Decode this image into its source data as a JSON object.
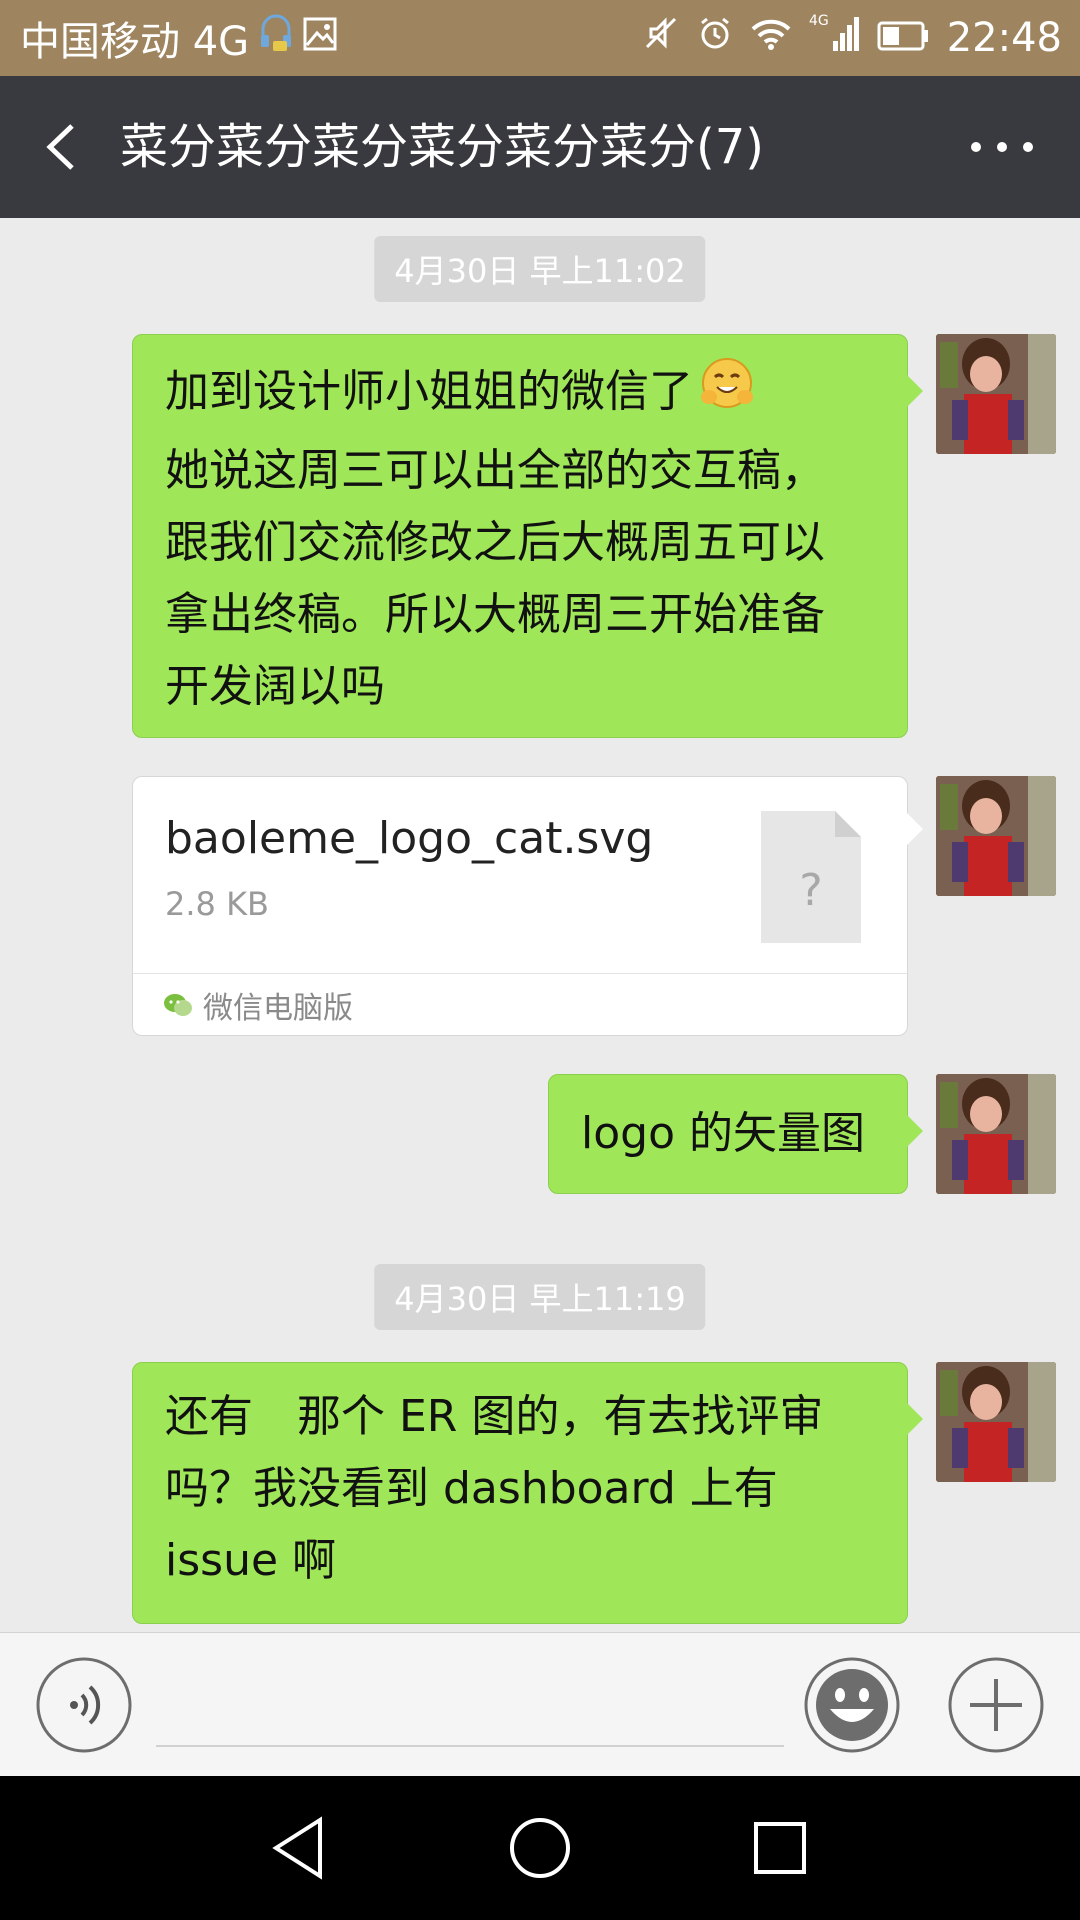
{
  "status_bar": {
    "carrier": "中国移动 4G",
    "network": "4G",
    "time": "22:48",
    "icons": [
      "headset-icon",
      "image-icon",
      "mute-icon",
      "alarm-icon",
      "wifi-icon",
      "signal-icon",
      "battery-icon"
    ]
  },
  "header": {
    "title": "菜分菜分菜分菜分菜分菜分(7)",
    "back_icon": "back-arrow-icon",
    "more_icon": "more-dots-icon"
  },
  "messages": [
    {
      "type": "timestamp",
      "text": "4月30日 早上11:02"
    },
    {
      "type": "text",
      "sender": "self",
      "lines": [
        "加到设计师小姐姐的微信了",
        "她说这周三可以出全部的交互稿，",
        "跟我们交流修改之后大概周五可以",
        "拿出终稿。所以大概周三开始准备",
        "开发阔以吗"
      ],
      "emoji": "smile-hands-emoji"
    },
    {
      "type": "file",
      "sender": "self",
      "file_name": "baoleme_logo_cat.svg",
      "file_size": "2.8 KB",
      "source": "微信电脑版",
      "icon_glyph": "?"
    },
    {
      "type": "text",
      "sender": "self",
      "lines": [
        "logo 的矢量图"
      ]
    },
    {
      "type": "timestamp",
      "text": "4月30日 早上11:19"
    },
    {
      "type": "text",
      "sender": "self",
      "lines": [
        "还有　那个 ER 图的，有去找评审",
        "吗？我没看到 dashboard 上有",
        "issue 啊"
      ]
    }
  ],
  "input_bar": {
    "placeholder": "",
    "value": "",
    "icons": [
      "voice-icon",
      "emoji-icon",
      "plus-icon"
    ]
  },
  "nav_bar": {
    "icons": [
      "nav-back-icon",
      "nav-home-icon",
      "nav-recents-icon"
    ]
  },
  "colors": {
    "status_bar_bg": "#9e8560",
    "title_bar_bg": "#393a3f",
    "chat_bg": "#ebebeb",
    "bubble_self": "#9fe658",
    "timestamp_bg": "#d6d6d6"
  }
}
